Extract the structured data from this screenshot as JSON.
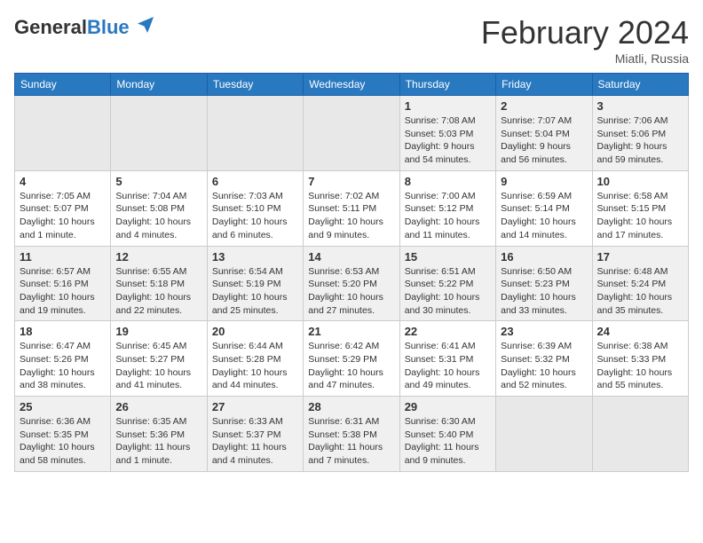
{
  "header": {
    "logo_general": "General",
    "logo_blue": "Blue",
    "month_title": "February 2024",
    "location": "Miatli, Russia"
  },
  "days_of_week": [
    "Sunday",
    "Monday",
    "Tuesday",
    "Wednesday",
    "Thursday",
    "Friday",
    "Saturday"
  ],
  "weeks": [
    [
      {
        "day": "",
        "info": ""
      },
      {
        "day": "",
        "info": ""
      },
      {
        "day": "",
        "info": ""
      },
      {
        "day": "",
        "info": ""
      },
      {
        "day": "1",
        "info": "Sunrise: 7:08 AM\nSunset: 5:03 PM\nDaylight: 9 hours\nand 54 minutes."
      },
      {
        "day": "2",
        "info": "Sunrise: 7:07 AM\nSunset: 5:04 PM\nDaylight: 9 hours\nand 56 minutes."
      },
      {
        "day": "3",
        "info": "Sunrise: 7:06 AM\nSunset: 5:06 PM\nDaylight: 9 hours\nand 59 minutes."
      }
    ],
    [
      {
        "day": "4",
        "info": "Sunrise: 7:05 AM\nSunset: 5:07 PM\nDaylight: 10 hours\nand 1 minute."
      },
      {
        "day": "5",
        "info": "Sunrise: 7:04 AM\nSunset: 5:08 PM\nDaylight: 10 hours\nand 4 minutes."
      },
      {
        "day": "6",
        "info": "Sunrise: 7:03 AM\nSunset: 5:10 PM\nDaylight: 10 hours\nand 6 minutes."
      },
      {
        "day": "7",
        "info": "Sunrise: 7:02 AM\nSunset: 5:11 PM\nDaylight: 10 hours\nand 9 minutes."
      },
      {
        "day": "8",
        "info": "Sunrise: 7:00 AM\nSunset: 5:12 PM\nDaylight: 10 hours\nand 11 minutes."
      },
      {
        "day": "9",
        "info": "Sunrise: 6:59 AM\nSunset: 5:14 PM\nDaylight: 10 hours\nand 14 minutes."
      },
      {
        "day": "10",
        "info": "Sunrise: 6:58 AM\nSunset: 5:15 PM\nDaylight: 10 hours\nand 17 minutes."
      }
    ],
    [
      {
        "day": "11",
        "info": "Sunrise: 6:57 AM\nSunset: 5:16 PM\nDaylight: 10 hours\nand 19 minutes."
      },
      {
        "day": "12",
        "info": "Sunrise: 6:55 AM\nSunset: 5:18 PM\nDaylight: 10 hours\nand 22 minutes."
      },
      {
        "day": "13",
        "info": "Sunrise: 6:54 AM\nSunset: 5:19 PM\nDaylight: 10 hours\nand 25 minutes."
      },
      {
        "day": "14",
        "info": "Sunrise: 6:53 AM\nSunset: 5:20 PM\nDaylight: 10 hours\nand 27 minutes."
      },
      {
        "day": "15",
        "info": "Sunrise: 6:51 AM\nSunset: 5:22 PM\nDaylight: 10 hours\nand 30 minutes."
      },
      {
        "day": "16",
        "info": "Sunrise: 6:50 AM\nSunset: 5:23 PM\nDaylight: 10 hours\nand 33 minutes."
      },
      {
        "day": "17",
        "info": "Sunrise: 6:48 AM\nSunset: 5:24 PM\nDaylight: 10 hours\nand 35 minutes."
      }
    ],
    [
      {
        "day": "18",
        "info": "Sunrise: 6:47 AM\nSunset: 5:26 PM\nDaylight: 10 hours\nand 38 minutes."
      },
      {
        "day": "19",
        "info": "Sunrise: 6:45 AM\nSunset: 5:27 PM\nDaylight: 10 hours\nand 41 minutes."
      },
      {
        "day": "20",
        "info": "Sunrise: 6:44 AM\nSunset: 5:28 PM\nDaylight: 10 hours\nand 44 minutes."
      },
      {
        "day": "21",
        "info": "Sunrise: 6:42 AM\nSunset: 5:29 PM\nDaylight: 10 hours\nand 47 minutes."
      },
      {
        "day": "22",
        "info": "Sunrise: 6:41 AM\nSunset: 5:31 PM\nDaylight: 10 hours\nand 49 minutes."
      },
      {
        "day": "23",
        "info": "Sunrise: 6:39 AM\nSunset: 5:32 PM\nDaylight: 10 hours\nand 52 minutes."
      },
      {
        "day": "24",
        "info": "Sunrise: 6:38 AM\nSunset: 5:33 PM\nDaylight: 10 hours\nand 55 minutes."
      }
    ],
    [
      {
        "day": "25",
        "info": "Sunrise: 6:36 AM\nSunset: 5:35 PM\nDaylight: 10 hours\nand 58 minutes."
      },
      {
        "day": "26",
        "info": "Sunrise: 6:35 AM\nSunset: 5:36 PM\nDaylight: 11 hours\nand 1 minute."
      },
      {
        "day": "27",
        "info": "Sunrise: 6:33 AM\nSunset: 5:37 PM\nDaylight: 11 hours\nand 4 minutes."
      },
      {
        "day": "28",
        "info": "Sunrise: 6:31 AM\nSunset: 5:38 PM\nDaylight: 11 hours\nand 7 minutes."
      },
      {
        "day": "29",
        "info": "Sunrise: 6:30 AM\nSunset: 5:40 PM\nDaylight: 11 hours\nand 9 minutes."
      },
      {
        "day": "",
        "info": ""
      },
      {
        "day": "",
        "info": ""
      }
    ]
  ]
}
